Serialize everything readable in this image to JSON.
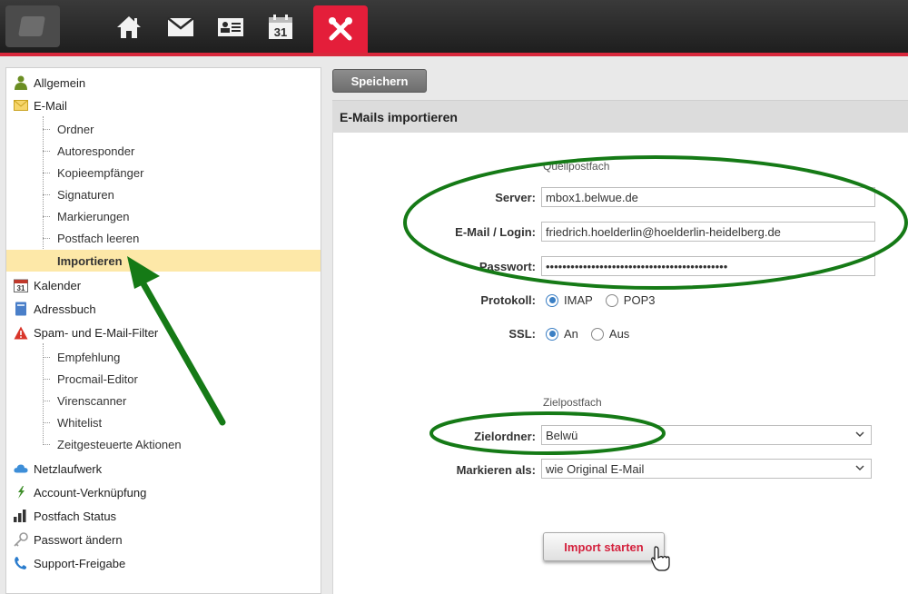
{
  "colors": {
    "accent": "#e41e3a",
    "highlight": "#fde8a8",
    "annotation": "#157a16",
    "radio": "#3b7fc4"
  },
  "topnav": {
    "icons": [
      "logo-icon",
      "home-icon",
      "mail-icon",
      "contact-card-icon",
      "calendar-icon",
      "tools-icon"
    ],
    "calendar_day": "31"
  },
  "sidebar": {
    "allgemein": "Allgemein",
    "email": "E-Mail",
    "email_sub": [
      "Ordner",
      "Autoresponder",
      "Kopieempfänger",
      "Signaturen",
      "Markierungen",
      "Postfach leeren",
      "Importieren"
    ],
    "kalender": "Kalender",
    "kalender_day": "31",
    "adressbuch": "Adressbuch",
    "spam": "Spam- und E-Mail-Filter",
    "spam_sub": [
      "Empfehlung",
      "Procmail-Editor",
      "Virenscanner",
      "Whitelist",
      "Zeitgesteuerte Aktionen"
    ],
    "netzlaufwerk": "Netzlaufwerk",
    "account": "Account-Verknüpfung",
    "status": "Postfach Status",
    "passwort": "Passwort ändern",
    "support": "Support-Freigabe"
  },
  "main": {
    "save_label": "Speichern",
    "panel_title": "E-Mails importieren",
    "source_title": "Quellpostfach",
    "server_label": "Server:",
    "server_value": "mbox1.belwue.de",
    "login_label": "E-Mail / Login:",
    "login_value": "friedrich.hoelderlin@hoelderlin-heidelberg.de",
    "password_label": "Passwort:",
    "password_value": "••••••••••••••••••••••••••••••••••••••••••••",
    "protocol_label": "Protokoll:",
    "protocol_options": [
      "IMAP",
      "POP3"
    ],
    "protocol_selected": "IMAP",
    "ssl_label": "SSL:",
    "ssl_options": [
      "An",
      "Aus"
    ],
    "ssl_selected": "An",
    "target_title": "Zielpostfach",
    "folder_label": "Zielordner:",
    "folder_value": "Belwü",
    "mark_label": "Markieren als:",
    "mark_value": "wie Original E-Mail",
    "import_label": "Import starten"
  }
}
